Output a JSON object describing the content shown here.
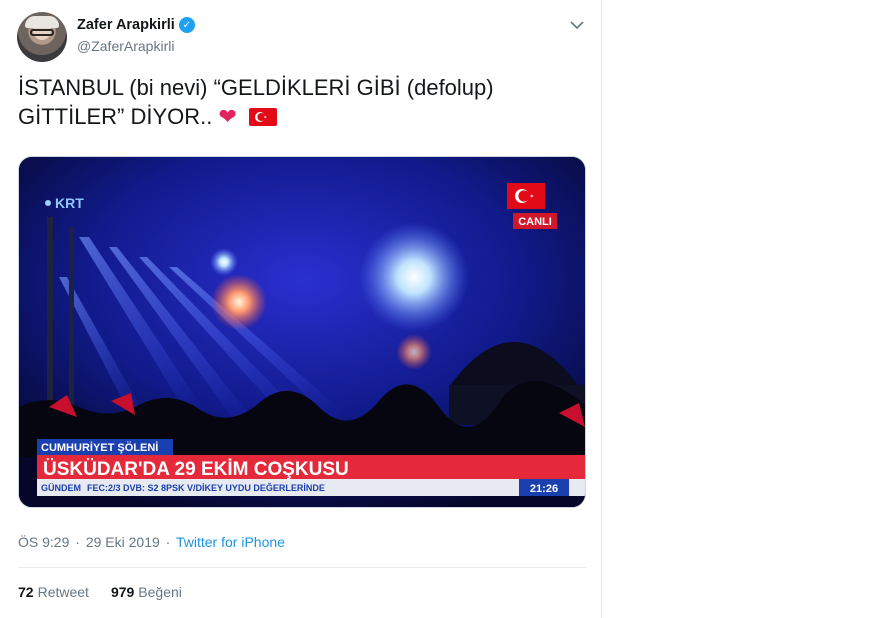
{
  "author": {
    "display_name": "Zafer Arapkirli",
    "handle": "@ZaferArapkirli",
    "verified_mark": "✓"
  },
  "tweet": {
    "text_line1": "İSTANBUL (bi nevi) “GELDİKLERİ GİBİ (defolup)",
    "text_line2": "GİTTİLER” DİYOR..",
    "emoji_heart": "❤",
    "emoji_flag": "turkey-flag-icon"
  },
  "media": {
    "channel_logo": "KRT",
    "live_badge": "CANLI",
    "program_label": "CUMHURİYET ŞÖLENİ",
    "headline": "ÜSKÜDAR'DA 29 EKİM COŞKUSU",
    "ticker_prefix": "GÜNDEM",
    "ticker_text": "FEC:2/3 DVB: S2 8PSK V/DİKEY UYDU DEĞERLERİNDE",
    "clock": "21:26"
  },
  "meta": {
    "time": "ÖS 9:29",
    "separator": "·",
    "date": "29 Eki 2019",
    "source": "Twitter for iPhone"
  },
  "stats": {
    "retweets_count": "72",
    "retweets_label": "Retweet",
    "likes_count": "979",
    "likes_label": "Beğeni"
  },
  "colors": {
    "accent": "#1da1f2",
    "link": "#1b95e0",
    "heart": "#e0245e",
    "flag_red": "#e30a17",
    "headline_red": "#e5293b"
  }
}
